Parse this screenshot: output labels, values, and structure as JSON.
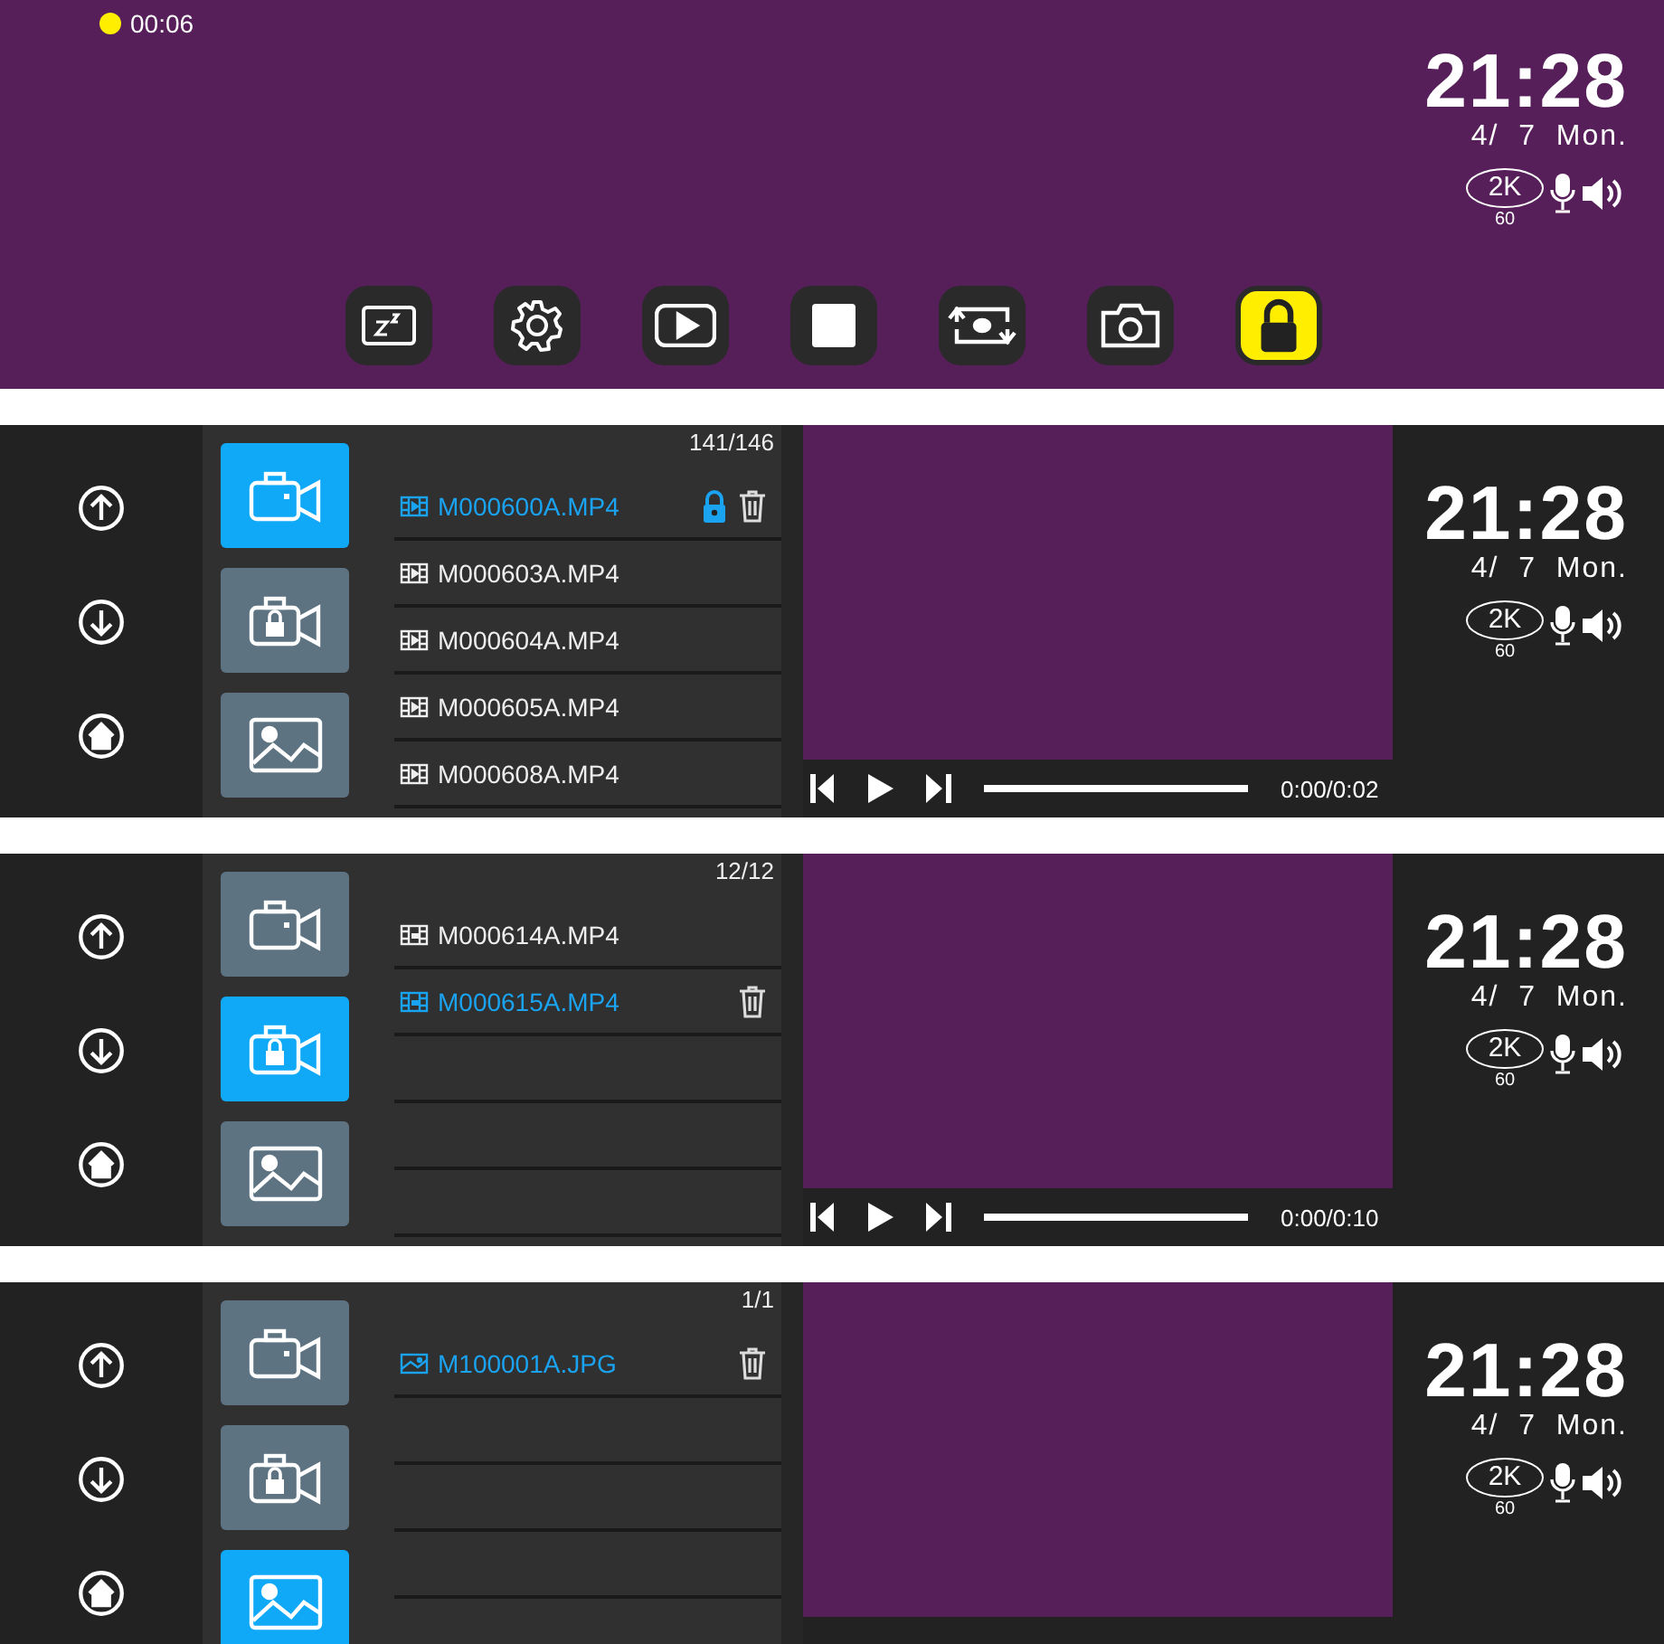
{
  "recorder": {
    "recording_dot": {
      "color": "#ffee00"
    },
    "elapsed": "00:06",
    "clock": {
      "time": "21:28",
      "date": "4/  7  Mon.",
      "resolution": "2K",
      "fps": "60"
    },
    "toolbar": [
      {
        "kind": "sleep",
        "selected": false
      },
      {
        "kind": "settings",
        "selected": false
      },
      {
        "kind": "playback",
        "selected": false
      },
      {
        "kind": "stop",
        "selected": false
      },
      {
        "kind": "switch",
        "selected": false
      },
      {
        "kind": "camera",
        "selected": false
      },
      {
        "kind": "lock",
        "selected": true
      }
    ]
  },
  "browsers": [
    {
      "tabs": [
        {
          "kind": "video",
          "selected": true
        },
        {
          "kind": "locked",
          "selected": false
        },
        {
          "kind": "photo",
          "selected": false
        }
      ],
      "counter": "141/146",
      "files": [
        {
          "name": "M000600A.MP4",
          "kind": "video",
          "selected": true,
          "locked": true
        },
        {
          "name": "M000603A.MP4",
          "kind": "video",
          "selected": false,
          "locked": false
        },
        {
          "name": "M000604A.MP4",
          "kind": "video",
          "selected": false,
          "locked": false
        },
        {
          "name": "M000605A.MP4",
          "kind": "video",
          "selected": false,
          "locked": false
        },
        {
          "name": "M000608A.MP4",
          "kind": "video",
          "selected": false,
          "locked": false
        }
      ],
      "player": {
        "time": "0:00/0:02",
        "level": 0
      },
      "clock": {
        "time": "21:28",
        "date": "4/  7  Mon.",
        "resolution": "2K",
        "fps": "60"
      }
    },
    {
      "tabs": [
        {
          "kind": "video",
          "selected": false
        },
        {
          "kind": "locked",
          "selected": true
        },
        {
          "kind": "photo",
          "selected": false
        }
      ],
      "counter": "12/12",
      "files": [
        {
          "name": "M000614A.MP4",
          "kind": "locked",
          "selected": false,
          "locked": false
        },
        {
          "name": "M000615A.MP4",
          "kind": "locked",
          "selected": true,
          "locked": false
        }
      ],
      "player": {
        "time": "0:00/0:10",
        "level": 0
      },
      "clock": {
        "time": "21:28",
        "date": "4/  7  Mon.",
        "resolution": "2K",
        "fps": "60"
      }
    },
    {
      "tabs": [
        {
          "kind": "video",
          "selected": false
        },
        {
          "kind": "locked",
          "selected": false
        },
        {
          "kind": "photo",
          "selected": true
        }
      ],
      "counter": "1/1",
      "files": [
        {
          "name": "M100001A.JPG",
          "kind": "photo",
          "selected": true,
          "locked": false
        }
      ],
      "clock": {
        "time": "21:28",
        "date": "4/  7  Mon.",
        "resolution": "2K",
        "fps": "60"
      }
    }
  ]
}
